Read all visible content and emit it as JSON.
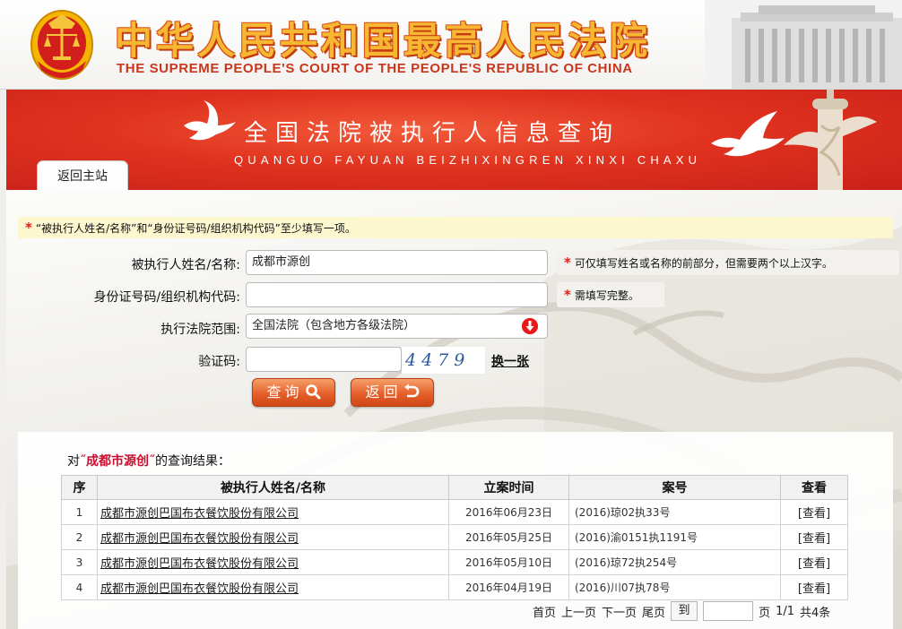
{
  "header": {
    "title_cn": "中华人民共和国最高人民法院",
    "title_en": "THE SUPREME PEOPLE'S COURT OF THE PEOPLE'S REPUBLIC OF CHINA"
  },
  "banner": {
    "title": "全国法院被执行人信息查询",
    "subtitle": "QUANGUO FAYUAN BEIZHIXINGREN XINXI CHAXU",
    "back_home_label": "返回主站"
  },
  "form": {
    "notice": "“被执行人姓名/名称”和“身份证号码/组织机构代码”至少填写一项。",
    "name_label": "被执行人姓名/名称:",
    "name_value": "成都市源创",
    "name_hint": "可仅填写姓名或名称的前部分，但需要两个以上汉字。",
    "id_label": "身份证号码/组织机构代码:",
    "id_value": "",
    "id_hint": "需填写完整。",
    "court_label": "执行法院范围:",
    "court_value": "全国法院（包含地方各级法院）",
    "captcha_label": "验证码:",
    "captcha_value": "",
    "captcha_text": "4479",
    "refresh_label": "换一张",
    "search_label": "查询",
    "back_label": "返回"
  },
  "results": {
    "prefix": "对",
    "keyword": "˝成都市源创˝",
    "suffix": "的查询结果：",
    "columns": [
      "序",
      "被执行人姓名/名称",
      "立案时间",
      "案号",
      "查看"
    ],
    "rows": [
      {
        "seq": "1",
        "name": "成都市源创巴国布衣餐饮股份有限公司",
        "date": "2016年06月23日",
        "case": "(2016)琼02执33号",
        "view": "[查看]"
      },
      {
        "seq": "2",
        "name": "成都市源创巴国布衣餐饮股份有限公司",
        "date": "2016年05月25日",
        "case": "(2016)渝0151执1191号",
        "view": "[查看]"
      },
      {
        "seq": "3",
        "name": "成都市源创巴国布衣餐饮股份有限公司",
        "date": "2016年05月10日",
        "case": "(2016)琼72执254号",
        "view": "[查看]"
      },
      {
        "seq": "4",
        "name": "成都市源创巴国布衣餐饮股份有限公司",
        "date": "2016年04月19日",
        "case": "(2016)川07执78号",
        "view": "[查看]"
      }
    ]
  },
  "pager": {
    "first": "首页",
    "prev": "上一页",
    "next": "下一页",
    "last": "尾页",
    "goto": "到",
    "page_input_value": "",
    "page_label": "页",
    "page_info": "1/1",
    "total": "共4条"
  },
  "colors": {
    "brand_red": "#e0321e",
    "warning_star": "#e8191b",
    "button_orange": "#e5602a",
    "notice_bg": "#fdf7cf",
    "keyword_red": "#c8102e"
  },
  "icons": {
    "emblem": "national-emblem-icon",
    "court_dropdown": "dropdown-arrow-icon",
    "search": "search-icon",
    "back": "back-arrow-icon"
  }
}
